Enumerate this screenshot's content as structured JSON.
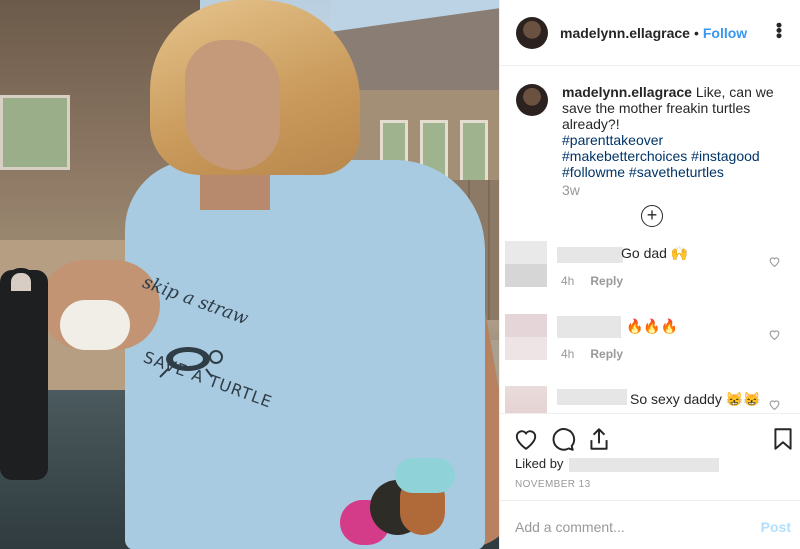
{
  "post": {
    "username": "madelynn.ellagrace",
    "follow_label": "Follow",
    "separator": "•",
    "more_label": "•••"
  },
  "caption": {
    "username": "madelynn.ellagrace",
    "text": "Like, can we save the mother freakin turtles already?!",
    "hashtags": "#parenttakeover #makebetterchoices #instagood #followme #savetheturtles",
    "time": "3w"
  },
  "load_more": {
    "icon": "plus-circle-icon",
    "label": "+"
  },
  "comments": [
    {
      "text": "Go dad 🙌",
      "time": "4h",
      "reply": "Reply"
    },
    {
      "text": "🔥🔥🔥",
      "time": "4h",
      "reply": "Reply"
    },
    {
      "text": "So sexy daddy 😸😸",
      "time": "",
      "reply": ""
    }
  ],
  "shirt_print": {
    "top": "skip a straw",
    "bottom": "SAVE A TURTLE"
  },
  "actions": {
    "icons": [
      "heart-icon",
      "comment-icon",
      "share-icon",
      "bookmark-icon"
    ]
  },
  "liked_by": {
    "label": "Liked by"
  },
  "date": "NOVEMBER 13",
  "add_comment": {
    "placeholder": "Add a comment...",
    "post_label": "Post"
  },
  "colors": {
    "accent": "#3897f0",
    "hashtag": "#003569",
    "muted": "#999999",
    "post_disabled": "#b2dffc"
  }
}
